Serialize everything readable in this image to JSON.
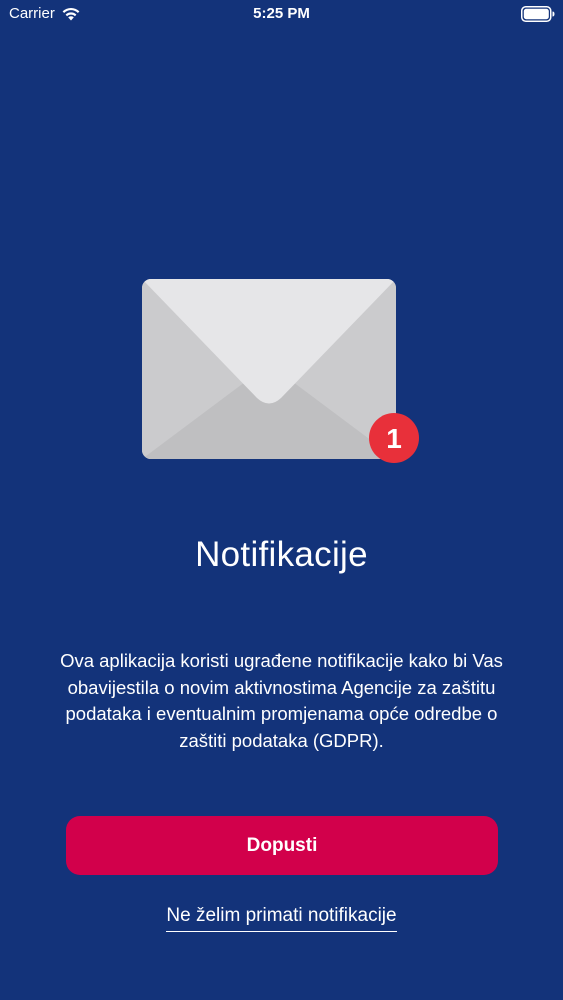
{
  "status_bar": {
    "carrier": "Carrier",
    "time": "5:25 PM",
    "icons": [
      "wifi-icon",
      "battery-icon"
    ]
  },
  "illustration": {
    "icon": "envelope-icon",
    "badge_count": "1",
    "badge_color": "#e8303a"
  },
  "title": "Notifikacije",
  "description": "Ova aplikacija koristi ugrađene notifikacije kako bi Vas obavijestila o novim aktivnostima Agencije za zaštitu podataka i eventualnim promjenama opće odredbe o zaštiti podataka (GDPR).",
  "buttons": {
    "allow_label": "Dopusti",
    "decline_label": "Ne želim primati notifikacije"
  },
  "colors": {
    "background": "#13337a",
    "accent": "#d2004b",
    "text": "#ffffff"
  }
}
